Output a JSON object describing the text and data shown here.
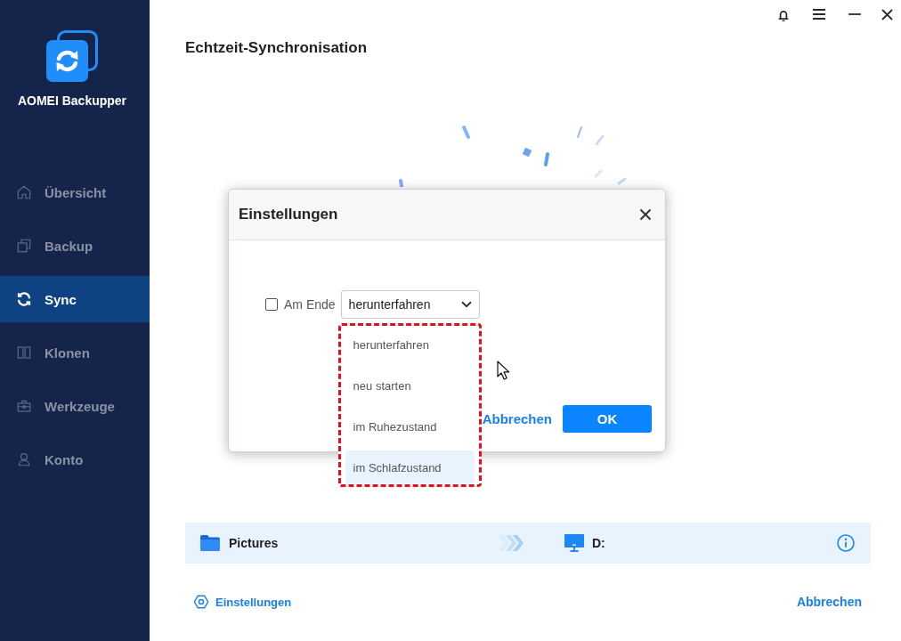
{
  "sidebar": {
    "app_name": "AOMEI Backupper",
    "items": [
      {
        "label": "Übersicht",
        "selected": false
      },
      {
        "label": "Backup",
        "selected": false
      },
      {
        "label": "Sync",
        "selected": true
      },
      {
        "label": "Klonen",
        "selected": false
      },
      {
        "label": "Werkzeuge",
        "selected": false
      },
      {
        "label": "Konto",
        "selected": false
      }
    ]
  },
  "page": {
    "title": "Echtzeit-Synchronisation"
  },
  "dialog": {
    "title": "Einstellungen",
    "shutdown": {
      "checked": false,
      "label": "Am Ende",
      "value": "herunterfahren",
      "expanded": true,
      "options": [
        {
          "label": "herunterfahren",
          "highlighted": false
        },
        {
          "label": "neu starten",
          "highlighted": false
        },
        {
          "label": "im Ruhezustand",
          "highlighted": false
        },
        {
          "label": "im Schlafzustand",
          "highlighted": true
        }
      ]
    },
    "buttons": [
      {
        "label": "Abbrechen",
        "kind": "link"
      },
      {
        "label": "OK",
        "kind": "primary"
      }
    ]
  },
  "sync_task": {
    "source": "Pictures",
    "destination": "D:"
  },
  "footer": {
    "settings_link": "Einstellungen",
    "cancel_button": "Abbrechen"
  }
}
